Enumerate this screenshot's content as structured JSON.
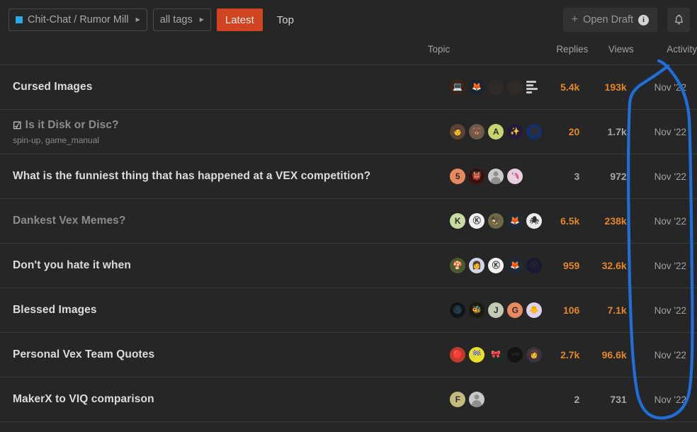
{
  "header": {
    "category": {
      "label": "Chit-Chat / Rumor Mill",
      "color": "#29a7e8",
      "caret": "▶"
    },
    "tags": {
      "label": "all tags",
      "caret": "▶"
    },
    "tabs": [
      {
        "label": "Latest",
        "active": true
      },
      {
        "label": "Top",
        "active": false
      }
    ],
    "draft": {
      "label": "Open Draft",
      "plus": "+",
      "info": "i"
    },
    "bell_icon": "bell-icon"
  },
  "table": {
    "columns": {
      "topic": "Topic",
      "replies": "Replies",
      "views": "Views",
      "activity": "Activity"
    },
    "rows": [
      {
        "title": "Cursed Images",
        "visited": false,
        "poll": false,
        "tags": "",
        "posters": [
          {
            "kind": "img",
            "style": "bg:#3a2418;em:💻"
          },
          {
            "kind": "img",
            "style": "bg:#1c2430;em:🦊"
          },
          {
            "kind": "img",
            "style": "bg:#2f2a28;em:✕"
          },
          {
            "kind": "img",
            "style": "bg:#2f2a28;em:٩"
          },
          {
            "kind": "poll-bars",
            "style": ""
          }
        ],
        "replies": "5.4k",
        "replies_hot": true,
        "views": "193k",
        "views_hot": true,
        "activity": "Nov '22"
      },
      {
        "title": "Is it Disk or Disc?",
        "visited": true,
        "poll": true,
        "tags": "spin-up, game_manual",
        "posters": [
          {
            "kind": "img",
            "style": "bg:#5a4430;em:🧑"
          },
          {
            "kind": "img",
            "style": "bg:#6b5a46;em:🐻"
          },
          {
            "kind": "letter",
            "style": "bg:#c9d66e",
            "text": "A"
          },
          {
            "kind": "img",
            "style": "bg:#251a3c;em:✨"
          },
          {
            "kind": "img",
            "style": "bg:#14306b;em:🅿"
          }
        ],
        "replies": "20",
        "replies_hot": true,
        "views": "1.7k",
        "views_hot": false,
        "activity": "Nov '22"
      },
      {
        "title": "What is the funniest thing that has happened at a VEX competition?",
        "visited": false,
        "poll": false,
        "tags": "",
        "posters": [
          {
            "kind": "letter",
            "style": "bg:#e98a5e",
            "text": "5"
          },
          {
            "kind": "img",
            "style": "bg:#3a0f0c;em:👹"
          },
          {
            "kind": "silhouette",
            "style": ""
          },
          {
            "kind": "img",
            "style": "bg:#e8cfe0;em:🦄"
          }
        ],
        "replies": "3",
        "replies_hot": false,
        "views": "972",
        "views_hot": false,
        "activity": "Nov '22"
      },
      {
        "title": "Dankest Vex Memes?",
        "visited": true,
        "poll": false,
        "tags": "",
        "posters": [
          {
            "kind": "letter",
            "style": "bg:#c7dca0",
            "text": "K"
          },
          {
            "kind": "img",
            "style": "bg:#f2f2f2;em:Ⓚ"
          },
          {
            "kind": "img",
            "style": "bg:#6d6a43;em:🦅"
          },
          {
            "kind": "img",
            "style": "bg:#1f2a38;em:🦊"
          },
          {
            "kind": "img",
            "style": "bg:#ededed;em:🕷"
          }
        ],
        "replies": "6.5k",
        "replies_hot": true,
        "views": "238k",
        "views_hot": true,
        "activity": "Nov '22"
      },
      {
        "title": "Don't you hate it when",
        "visited": false,
        "poll": false,
        "tags": "",
        "posters": [
          {
            "kind": "img",
            "style": "bg:#4a5a2e;em:🍄"
          },
          {
            "kind": "img",
            "style": "bg:#cfd8e6;em:👩"
          },
          {
            "kind": "img",
            "style": "bg:#f2f2f2;em:Ⓚ"
          },
          {
            "kind": "img",
            "style": "bg:#1f2a38;em:🦊"
          },
          {
            "kind": "img",
            "style": "bg:#161b33;em:Ⓥ"
          }
        ],
        "replies": "959",
        "replies_hot": true,
        "views": "32.6k",
        "views_hot": true,
        "activity": "Nov '22"
      },
      {
        "title": "Blessed Images",
        "visited": false,
        "poll": false,
        "tags": "",
        "posters": [
          {
            "kind": "img",
            "style": "bg:#101418;em:🌑"
          },
          {
            "kind": "img",
            "style": "bg:#1a1a10;em:🐝"
          },
          {
            "kind": "letter",
            "style": "bg:#c2ccb4",
            "text": "J"
          },
          {
            "kind": "letter",
            "style": "bg:#e98a5e",
            "text": "G"
          },
          {
            "kind": "img",
            "style": "bg:#ded0ef;em:🐥"
          }
        ],
        "replies": "106",
        "replies_hot": true,
        "views": "7.1k",
        "views_hot": true,
        "activity": "Nov '22"
      },
      {
        "title": "Personal Vex Team Quotes",
        "visited": false,
        "poll": false,
        "tags": "",
        "posters": [
          {
            "kind": "img",
            "style": "bg:#c0392b;em:🔴"
          },
          {
            "kind": "img",
            "style": "bg:#e8e02a;em:🏁"
          },
          {
            "kind": "img",
            "style": "bg:#1e2a24;em:🎀"
          },
          {
            "kind": "img",
            "style": "bg:#141414;em:〰"
          },
          {
            "kind": "img",
            "style": "bg:#3b3340;em:👩"
          }
        ],
        "replies": "2.7k",
        "replies_hot": true,
        "views": "96.6k",
        "views_hot": true,
        "activity": "Nov '22"
      },
      {
        "title": "MakerX to VIQ comparison",
        "visited": false,
        "poll": false,
        "tags": "",
        "posters": [
          {
            "kind": "letter",
            "style": "bg:#c4bc7e",
            "text": "F"
          },
          {
            "kind": "silhouette",
            "style": ""
          }
        ],
        "replies": "2",
        "replies_hot": false,
        "views": "731",
        "views_hot": false,
        "activity": "Nov '22"
      }
    ]
  },
  "annotation": {
    "type": "hand-drawn-loop",
    "color": "#1f6fdb",
    "target": "activity-column"
  }
}
